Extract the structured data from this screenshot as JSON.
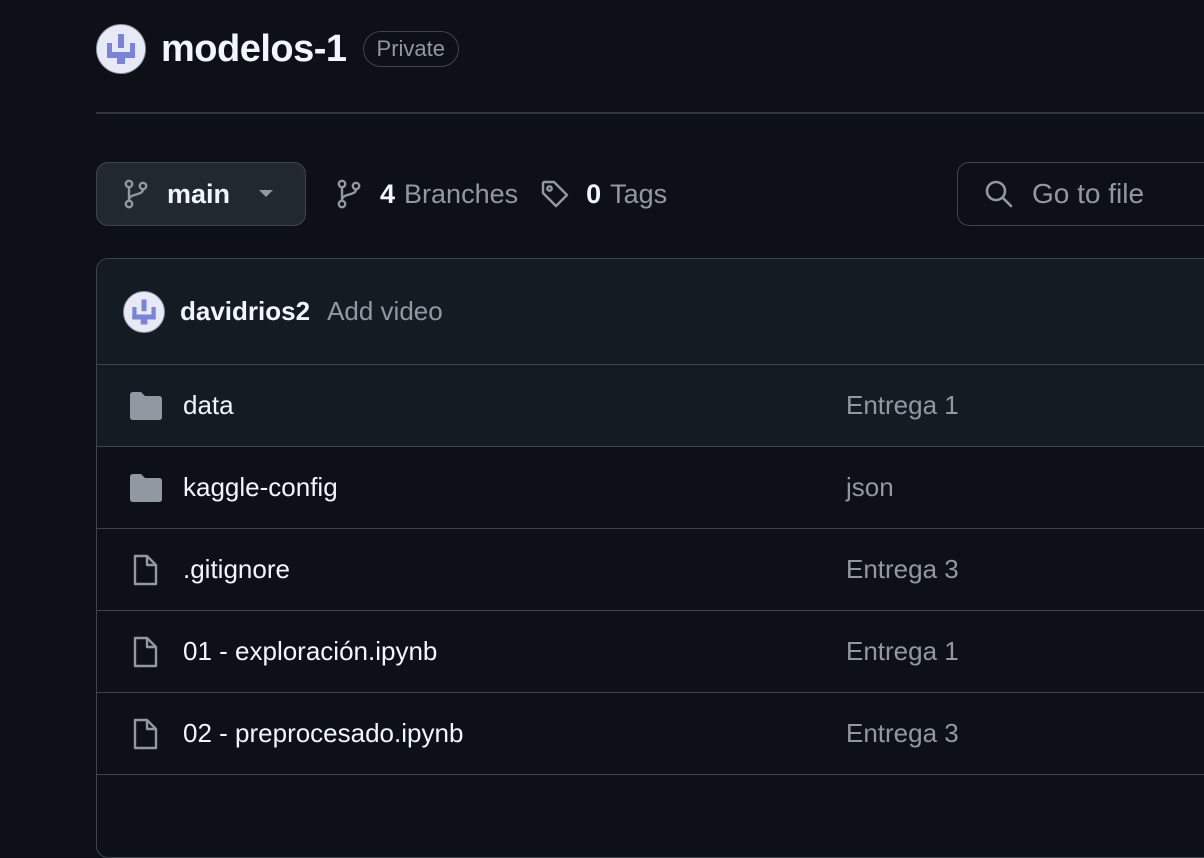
{
  "repo": {
    "name": "modelos-1",
    "visibility": "Private"
  },
  "toolbar": {
    "branch": "main",
    "branches_count": "4",
    "branches_label": "Branches",
    "tags_count": "0",
    "tags_label": "Tags"
  },
  "search": {
    "placeholder": "Go to file"
  },
  "latest_commit": {
    "author": "davidrios2",
    "message": "Add video"
  },
  "files": [
    {
      "name": "data",
      "type": "folder",
      "commit": "Entrega 1"
    },
    {
      "name": "kaggle-config",
      "type": "folder",
      "commit": "json"
    },
    {
      "name": ".gitignore",
      "type": "file",
      "commit": "Entrega 3"
    },
    {
      "name": "01 - exploración.ipynb",
      "type": "file",
      "commit": "Entrega 1"
    },
    {
      "name": "02 - preprocesado.ipynb",
      "type": "file",
      "commit": "Entrega 3"
    }
  ],
  "colors": {
    "background": "#0d1117",
    "border": "#3d444d",
    "muted_text": "#9198a1",
    "avatar_accent": "#7b83d6"
  },
  "icons": {
    "owner_avatar": "owner-avatar-icon",
    "branch": "git-branch-icon",
    "caret": "caret-down-icon",
    "tag": "tag-icon",
    "search": "search-icon",
    "folder": "folder-icon",
    "file": "file-icon"
  }
}
